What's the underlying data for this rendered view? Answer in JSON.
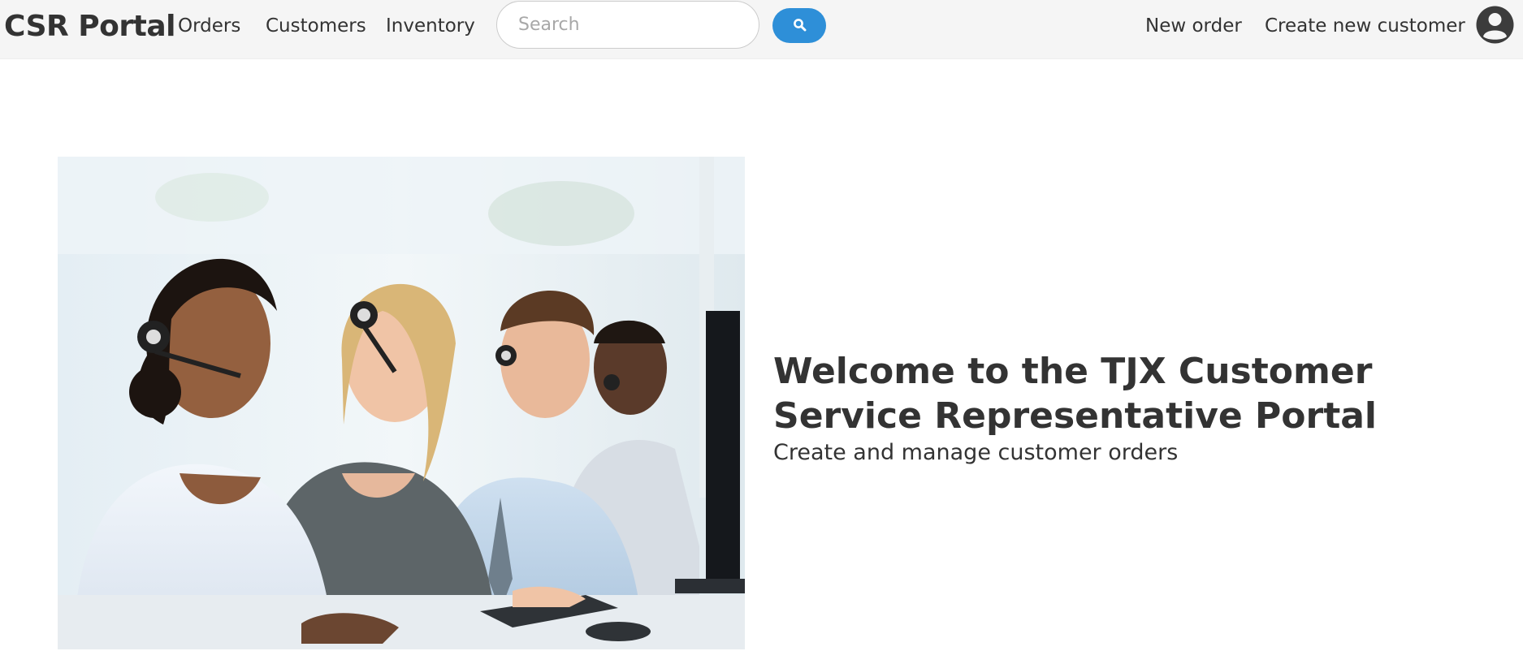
{
  "navbar": {
    "brand": "CSR Portal",
    "links": [
      "Orders",
      "Customers",
      "Inventory"
    ],
    "search": {
      "placeholder": "Search",
      "value": ""
    },
    "search_button_icon": "search-icon",
    "right_links": [
      "New order",
      "Create new customer"
    ],
    "avatar_icon": "user-circle-icon"
  },
  "hero": {
    "title": "Welcome to the TJX Customer Service Representative Portal",
    "subtitle": "Create and manage customer orders",
    "image": "call-center-agents-with-headsets-photo"
  },
  "colors": {
    "navbar_bg": "#f5f5f5",
    "accent": "#2e8fd8",
    "text": "#333333"
  }
}
